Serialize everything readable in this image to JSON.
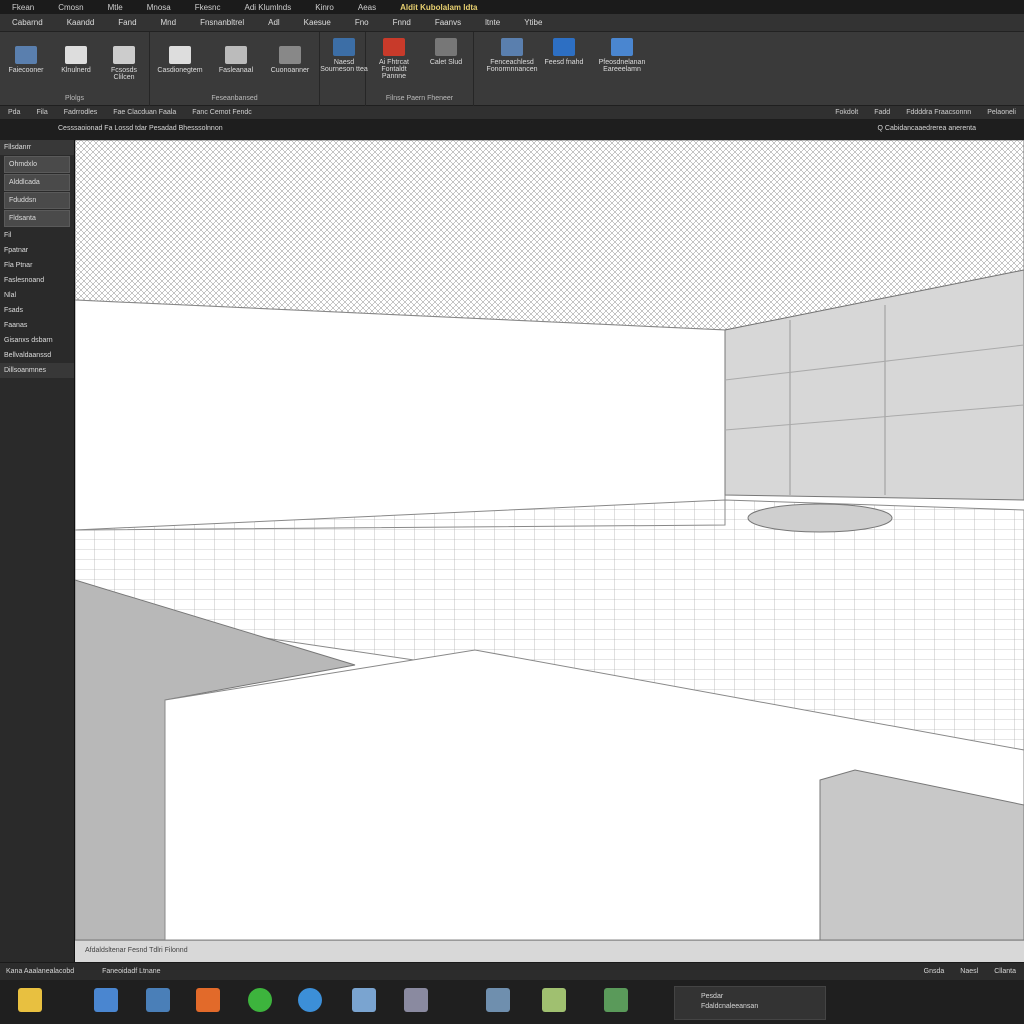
{
  "titlebar": {
    "items": [
      "Fkean",
      "Cmosn",
      "Mtle",
      "Mnosa",
      "Fkesnc",
      "Adi Klumlnds",
      "Kinro",
      "Aeas"
    ],
    "app_title": "Aldit Kubolalam ldta",
    "accent_color": "#e8d070"
  },
  "menubar": {
    "tabs": [
      "Cabarnd",
      "Kaandd",
      "Fand",
      "Mnd",
      "Fnsnanbltrel",
      "Adl",
      "Kaesue",
      "Fno",
      "Fnnd",
      "Faanvs",
      "ltnte",
      "Ytibe"
    ]
  },
  "ribbon": {
    "groups": [
      {
        "buttons": [
          "Faiecooner",
          "Klnulnerd",
          "Fcsosds Clilcen"
        ],
        "label": "Plolgs",
        "icon_colors": [
          "#5a7fae",
          "#ddd",
          "#ccc"
        ]
      },
      {
        "buttons": [
          "Casdionegtem",
          "Fasleanaal",
          "Cuonoanner"
        ],
        "label": "Feseanbansed",
        "icon_colors": [
          "#ddd",
          "#bbb",
          "#888"
        ]
      },
      {
        "buttons": [
          "Naesd Sourneson ttea"
        ],
        "label": "",
        "icon_colors": [
          "#3c6ea6"
        ]
      },
      {
        "buttons": [
          "Ai Fhtrcat Fontaldt Pannne",
          "Calet Slud"
        ],
        "label": "Filnse Paern Fheneer",
        "icon_colors": [
          "#c83a2a",
          "#777"
        ]
      },
      {
        "buttons": [
          "Fenceachlesd Fonormnnancen",
          "Feesd fnahd",
          "Pfeosdnelanan Eareeelamn"
        ],
        "label": "",
        "icon_colors": [
          "#5a7fae",
          "#2d6fc3",
          "#4a86d0"
        ]
      }
    ]
  },
  "subbar": {
    "left_items": [
      "Pda",
      "Fila",
      "Fadrrodles",
      "Fae Clacduan Faala",
      "Fanc Cemot Fendc"
    ],
    "right_items": [
      "Fokdolt",
      "Fadd",
      "Fddddra Fraacsonnn",
      "Pelaoneli"
    ]
  },
  "infobar": {
    "left_text": "Cesssaoionad Fa Lossd tdar Pesadad Bhesssolnnon",
    "right_text": "Q Cabidancaaedrerea anerenta"
  },
  "leftpanel": {
    "items": [
      {
        "label": "Fllsdanrr",
        "type": "hdr"
      },
      {
        "label": "Ohmdxlo",
        "type": "sel"
      },
      {
        "label": "Alddlcada",
        "type": "sel"
      },
      {
        "label": "Fduddsn",
        "type": "sel"
      },
      {
        "label": "Fldsanta",
        "type": "sel"
      },
      {
        "label": "Fil",
        "type": "item"
      },
      {
        "label": "Fpatnar",
        "type": "item"
      },
      {
        "label": "Fla Ptnar",
        "type": "item"
      },
      {
        "label": "Faslesnoand",
        "type": "item"
      },
      {
        "label": "Nlal",
        "type": "item"
      },
      {
        "label": "Fsads",
        "type": "item"
      },
      {
        "label": "Faanas",
        "type": "item"
      },
      {
        "label": "Gisanxs dsbarn",
        "type": "item"
      },
      {
        "label": "Bellvaldaanssd",
        "type": "item"
      },
      {
        "label": "Dillsoanmnes",
        "type": "hdr"
      }
    ]
  },
  "viewport_status": "Afdaldsltenar Fesnd Tdlri Filonnd",
  "bottombar": {
    "left_items": [
      "Kana Aaalanealacobd",
      "Faneoidadf Ltnane"
    ],
    "right_items": [
      "Gnsda",
      "Naesl",
      "Cllanta"
    ]
  },
  "taskbar": {
    "window1": "Pesdar",
    "window2": "Fdaldcnaleeansan",
    "icon_colors": [
      "#e8c040",
      "#4a86d0",
      "#4a7fb8",
      "#e26a2a",
      "#3db43d",
      "#3c8fd8",
      "#7aa4d0",
      "#8a8aa0",
      "#6f8fae",
      "#a0c070",
      "#5a9a5a"
    ]
  }
}
